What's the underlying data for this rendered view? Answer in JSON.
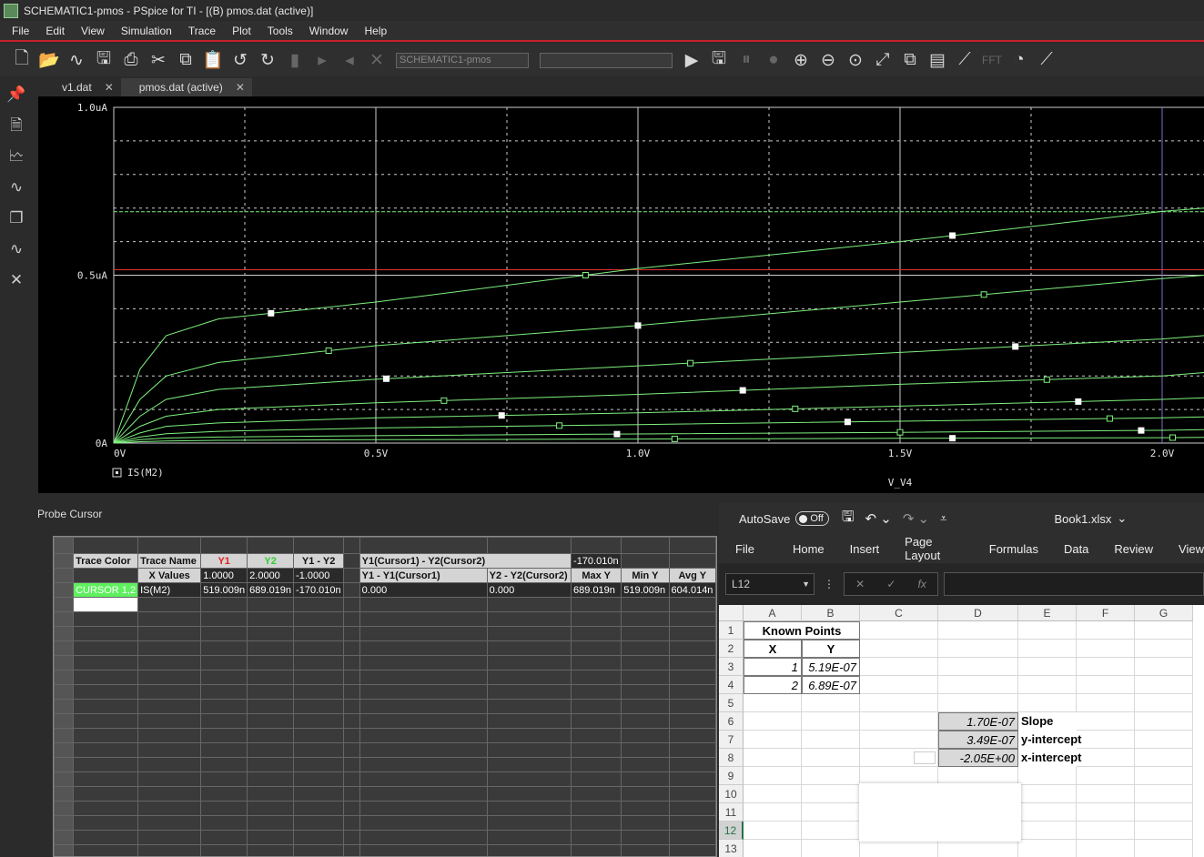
{
  "window": {
    "title": "SCHEMATIC1-pmos - PSpice for TI - [(B) pmos.dat (active)]"
  },
  "menu": [
    "File",
    "Edit",
    "View",
    "Simulation",
    "Trace",
    "Plot",
    "Tools",
    "Window",
    "Help"
  ],
  "toolbar": {
    "profile_value": "SCHEMATIC1-pmos",
    "fft_label": "FFT"
  },
  "tabs": [
    {
      "label": "v1.dat",
      "close": "✕"
    },
    {
      "label": "pmos.dat (active)",
      "close": "✕"
    }
  ],
  "plot": {
    "y_ticks": [
      "1.0uA",
      "0.5uA",
      "0A"
    ],
    "x_ticks": [
      "0V",
      "0.5V",
      "1.0V",
      "1.5V",
      "2.0V"
    ],
    "xlabel": "V_V4",
    "legend": "IS(M2)",
    "colors": {
      "trace": "#7ef07e",
      "cursor_h": "#e03030",
      "cursor_v": "#8a6ad0",
      "grid": "#cccccc"
    }
  },
  "chart_data": {
    "type": "line",
    "x_range": [
      0,
      2.08
    ],
    "y_range_uA": [
      0,
      1.0
    ],
    "xlabel": "V_V4",
    "legend": [
      "IS(M2)"
    ],
    "series": [
      {
        "x": [
          0,
          0.05,
          0.1,
          0.2,
          0.5,
          1.0,
          1.5,
          2.0,
          2.08
        ],
        "y_uA": [
          0,
          0.22,
          0.32,
          0.37,
          0.42,
          0.52,
          0.6,
          0.69,
          0.7
        ]
      },
      {
        "x": [
          0,
          0.05,
          0.1,
          0.2,
          0.5,
          1.0,
          1.5,
          2.0,
          2.08
        ],
        "y_uA": [
          0,
          0.13,
          0.2,
          0.24,
          0.29,
          0.35,
          0.42,
          0.49,
          0.5
        ]
      },
      {
        "x": [
          0,
          0.05,
          0.1,
          0.2,
          0.5,
          1.0,
          1.5,
          2.0,
          2.08
        ],
        "y_uA": [
          0,
          0.08,
          0.13,
          0.16,
          0.19,
          0.23,
          0.27,
          0.31,
          0.32
        ]
      },
      {
        "x": [
          0,
          0.05,
          0.1,
          0.2,
          0.5,
          1.0,
          1.5,
          2.0,
          2.08
        ],
        "y_uA": [
          0,
          0.05,
          0.08,
          0.1,
          0.12,
          0.145,
          0.175,
          0.2,
          0.21
        ]
      },
      {
        "x": [
          0,
          0.05,
          0.1,
          0.2,
          0.5,
          1.0,
          1.5,
          2.0,
          2.08
        ],
        "y_uA": [
          0,
          0.03,
          0.05,
          0.06,
          0.075,
          0.09,
          0.11,
          0.13,
          0.135
        ]
      },
      {
        "x": [
          0,
          0.05,
          0.1,
          0.2,
          0.5,
          1.0,
          1.5,
          2.0,
          2.08
        ],
        "y_uA": [
          0,
          0.018,
          0.028,
          0.035,
          0.045,
          0.055,
          0.065,
          0.075,
          0.078
        ]
      },
      {
        "x": [
          0,
          0.05,
          0.1,
          0.2,
          0.5,
          1.0,
          1.5,
          2.0,
          2.08
        ],
        "y_uA": [
          0,
          0.01,
          0.015,
          0.018,
          0.022,
          0.027,
          0.032,
          0.038,
          0.04
        ]
      },
      {
        "x": [
          0,
          0.05,
          0.1,
          0.2,
          0.5,
          1.0,
          1.5,
          2.0,
          2.08
        ],
        "y_uA": [
          0,
          0.004,
          0.006,
          0.008,
          0.01,
          0.012,
          0.014,
          0.016,
          0.017
        ]
      }
    ],
    "cursor_y_uA": 0.519,
    "cursor2_y_uA": 0.689,
    "cursor2_x": 2.0
  },
  "probe": {
    "title": "Probe Cursor",
    "headers": [
      "Trace Color",
      "Trace Name",
      "Y1",
      "Y2",
      "Y1 - Y2",
      "",
      "Y1(Cursor1) - Y2(Cursor2)",
      "",
      "-170.010n"
    ],
    "row2": [
      "",
      "X Values",
      "1.0000",
      "2.0000",
      "-1.0000",
      "",
      "Y1 - Y1(Cursor1)",
      "Y2 - Y2(Cursor2)",
      "Max Y",
      "Min Y",
      "Avg Y"
    ],
    "row3": [
      "CURSOR 1,2",
      "IS(M2)",
      "519.009n",
      "689.019n",
      "-170.010n",
      "",
      "0.000",
      "0.000",
      "689.019n",
      "519.009n",
      "604.014n"
    ]
  },
  "excel": {
    "autosave": "AutoSave",
    "toggle": "Off",
    "filename": "Book1.xlsx",
    "ribbon": [
      "File",
      "Home",
      "Insert",
      "Page Layout",
      "Formulas",
      "Data",
      "Review",
      "View"
    ],
    "namebox": "L12",
    "cols": [
      "A",
      "B",
      "C",
      "D",
      "E",
      "F",
      "G"
    ],
    "rows": [
      "1",
      "2",
      "3",
      "4",
      "5",
      "6",
      "7",
      "8",
      "9",
      "10",
      "11",
      "12",
      "13"
    ],
    "cells": {
      "A1": "Known Points",
      "A2": "X",
      "B2": "Y",
      "A3": "1",
      "B3": "5.19E-07",
      "A4": "2",
      "B4": "6.89E-07",
      "D6": "1.70E-07",
      "E6": "Slope",
      "D7": "3.49E-07",
      "E7": "y-intercept",
      "D8": "-2.05E+00",
      "E8": "x-intercept"
    }
  }
}
